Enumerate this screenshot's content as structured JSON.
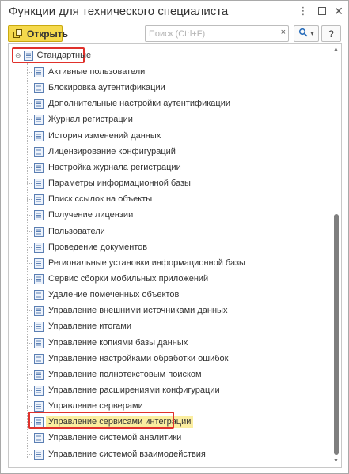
{
  "window": {
    "title": "Функции для технического специалиста",
    "controls": {
      "menu_icon": "more-vertical-icon",
      "maximize_icon": "maximize-icon",
      "close_icon": "close-icon"
    }
  },
  "toolbar": {
    "open_label": "Открыть",
    "open_icon": "open-icon",
    "search_placeholder": "Поиск (Ctrl+F)",
    "search_value": "",
    "clear_label": "×",
    "search_button_icon": "search-icon",
    "search_button_dropdown": "▾",
    "help_label": "?"
  },
  "tree": {
    "root_label": "Стандартные",
    "root_collapse_glyph": "⊖",
    "selected_index": 23,
    "items": [
      "Активные пользователи",
      "Блокировка аутентификации",
      "Дополнительные настройки аутентификации",
      "Журнал регистрации",
      "История изменений данных",
      "Лицензирование конфигураций",
      "Настройка журнала регистрации",
      "Параметры информационной базы",
      "Поиск ссылок на объекты",
      "Получение лицензии",
      "Пользователи",
      "Проведение документов",
      "Региональные установки информационной базы",
      "Сервис сборки мобильных приложений",
      "Удаление помеченных объектов",
      "Управление внешними источниками данных",
      "Управление итогами",
      "Управление копиями базы данных",
      "Управление настройками обработки ошибок",
      "Управление полнотекстовым поиском",
      "Управление расширениями конфигурации",
      "Управление серверами",
      "Управление сервисами интеграции",
      "Управление системой аналитики",
      "Управление системой взаимодействия"
    ]
  },
  "colors": {
    "accent_yellow": "#f5d94c",
    "highlight_red": "#e0312b",
    "selection_yellow": "#fbeea0"
  }
}
